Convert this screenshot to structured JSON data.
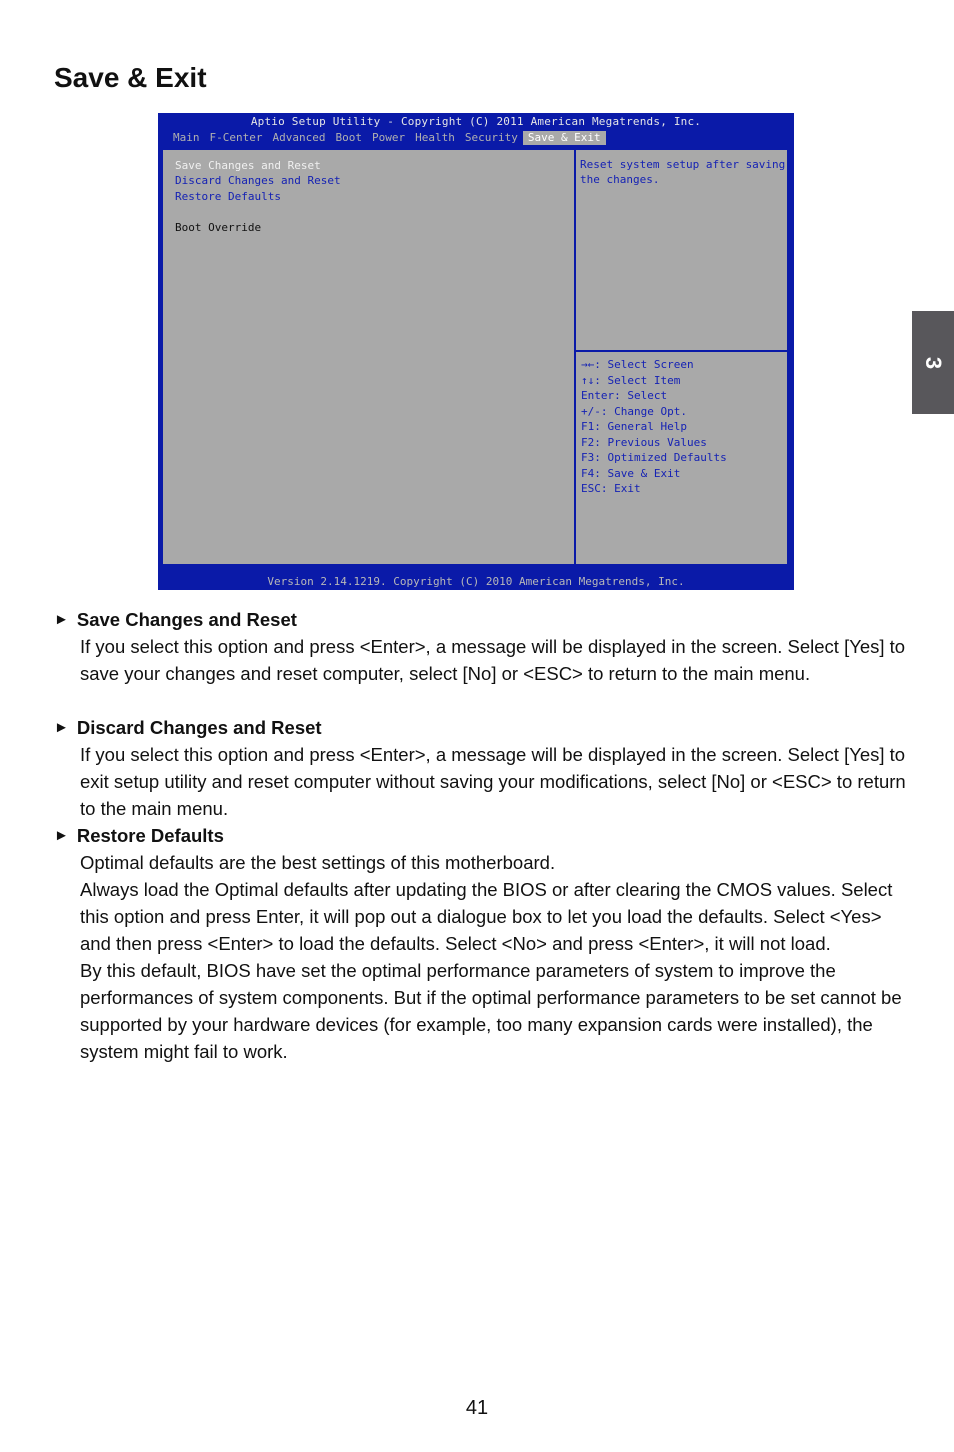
{
  "page_title": "Save & Exit",
  "chapter_tab": "3",
  "bios": {
    "title": "Aptio Setup Utility - Copyright (C) 2011 American Megatrends, Inc.",
    "menu_tabs": [
      "Main",
      "F-Center",
      "Advanced",
      "Boot",
      "Power",
      "Health",
      "Security",
      "Save & Exit"
    ],
    "active_tab": "Save & Exit",
    "items": [
      {
        "label": "Save Changes and Reset",
        "state": "selected"
      },
      {
        "label": "Discard Changes and Reset",
        "state": "option"
      },
      {
        "label": "Restore Defaults",
        "state": "option"
      },
      {
        "label": "Boot Override",
        "state": "heading"
      }
    ],
    "help_text": "Reset system setup after saving the changes.",
    "keys": [
      "→←: Select Screen",
      "↑↓: Select Item",
      "Enter: Select",
      "+/-: Change Opt.",
      "F1: General Help",
      "F2: Previous Values",
      "F3: Optimized Defaults",
      "F4: Save & Exit",
      "ESC: Exit"
    ],
    "footer": "Version 2.14.1219. Copyright (C) 2010 American Megatrends, Inc."
  },
  "sections": [
    {
      "heading": "Save Changes and Reset",
      "paragraphs": [
        "If you select this option and press <Enter>, a message will be displayed in the screen. Select [Yes] to save your changes and reset computer, select [No] or <ESC> to return to the main menu."
      ]
    },
    {
      "heading": "Discard Changes and Reset",
      "paragraphs": [
        "If you select this option and press <Enter>,  a message will be displayed in the screen. Select [Yes] to exit setup utility and reset computer without saving your modifications, select [No] or <ESC> to return to the main menu."
      ]
    },
    {
      "heading": "Restore Defaults",
      "paragraphs": [
        "Optimal defaults are the best settings of this motherboard.",
        "Always load the Optimal defaults after updating the BIOS or after clearing the CMOS values. Select this option and press Enter, it will pop out a dialogue box to let you load the defaults. Select <Yes> and then press <Enter> to load the defaults. Select <No> and press <Enter>, it will not load.",
        "By this default, BIOS have set the optimal performance parameters of system to improve the performances of system components. But if the optimal performance parameters to be set cannot be supported by your hardware devices (for example, too many expansion cards were installed), the system might fail to work."
      ]
    }
  ],
  "page_number": "41"
}
